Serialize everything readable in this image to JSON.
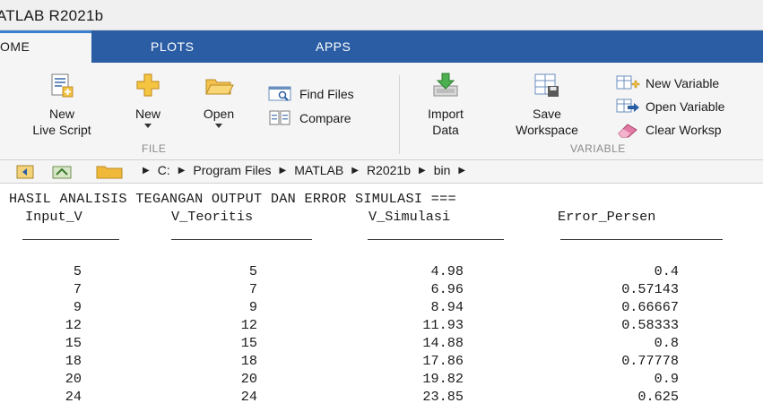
{
  "window": {
    "title": "ATLAB R2021b"
  },
  "tabs": [
    {
      "label": "OME",
      "active": true
    },
    {
      "label": "PLOTS",
      "active": false
    },
    {
      "label": "APPS",
      "active": false
    }
  ],
  "ribbon": {
    "file": {
      "section_label": "FILE",
      "new_live_script": {
        "line1": "New",
        "line2": "Live Script"
      },
      "new": "New",
      "open": "Open",
      "find_files": "Find Files",
      "compare": "Compare"
    },
    "variable": {
      "section_label": "VARIABLE",
      "import_data": {
        "line1": "Import",
        "line2": "Data"
      },
      "save_workspace": {
        "line1": "Save",
        "line2": "Workspace"
      },
      "new_variable": "New Variable",
      "open_variable": "Open Variable",
      "clear_workspace": "Clear Worksp"
    }
  },
  "address": {
    "path": [
      "C:",
      "Program Files",
      "MATLAB",
      "R2021b",
      "bin"
    ]
  },
  "console": {
    "header": "HASIL ANALISIS TEGANGAN OUTPUT DAN ERROR SIMULASI ===",
    "columns": [
      "Input_V",
      "V_Teoritis",
      "V_Simulasi",
      "Error_Persen"
    ],
    "rows": [
      [
        "5",
        "5",
        "4.98",
        "0.4"
      ],
      [
        "7",
        "7",
        "6.96",
        "0.57143"
      ],
      [
        "9",
        "9",
        "8.94",
        "0.66667"
      ],
      [
        "12",
        "12",
        "11.93",
        "0.58333"
      ],
      [
        "15",
        "15",
        "14.88",
        "0.8"
      ],
      [
        "18",
        "18",
        "17.86",
        "0.77778"
      ],
      [
        "20",
        "20",
        "19.82",
        "0.9"
      ],
      [
        "24",
        "24",
        "23.85",
        "0.625"
      ]
    ]
  },
  "colors": {
    "tab_bar": "#2a5da4",
    "ribbon_bg": "#f5f5f5",
    "folder_yellow": "#f0c040",
    "console_bg": "#ffffff"
  }
}
